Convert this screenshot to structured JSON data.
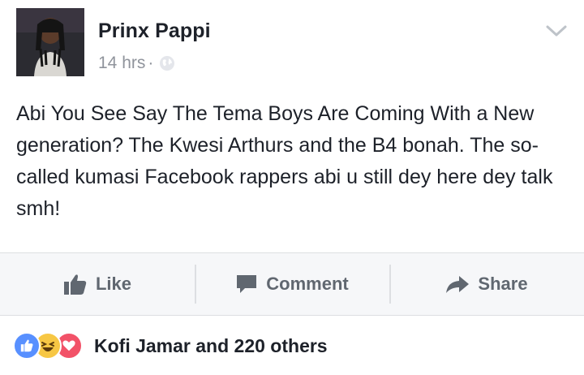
{
  "post": {
    "author": "Prinx Pappi",
    "time": "14 hrs",
    "separator": "·",
    "privacy_icon": "globe-icon",
    "menu_icon": "chevron-down-icon",
    "text": "Abi You See Say The Tema Boys Are Coming With a New generation? The Kwesi Arthurs and the B4 bonah. The so-called kumasi Facebook rappers abi u still dey here dey talk smh!"
  },
  "actions": {
    "like_label": "Like",
    "comment_label": "Comment",
    "share_label": "Share"
  },
  "reactions": {
    "icons": [
      "like-reaction-icon",
      "haha-reaction-icon",
      "love-reaction-icon"
    ],
    "summary": "Kofi Jamar and 220 others"
  },
  "colors": {
    "like_blue": "#5890ff",
    "haha_yellow": "#f7c744",
    "love_red": "#f25268",
    "action_gray": "#606770",
    "meta_gray": "#90949c"
  }
}
